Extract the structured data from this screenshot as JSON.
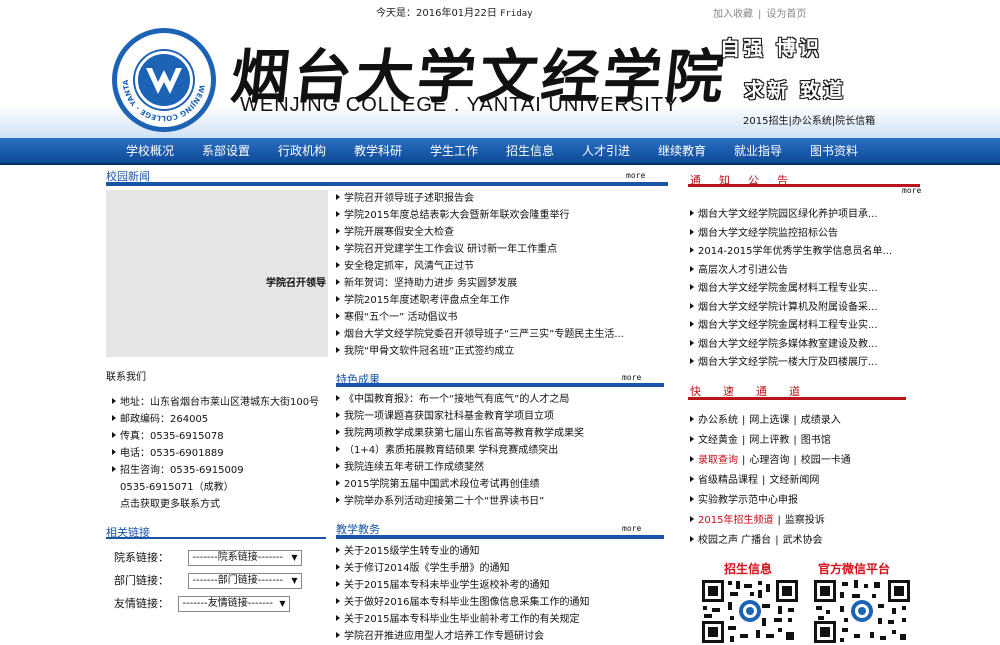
{
  "topbar": {
    "date_prefix": "今天是：2016年01月22日",
    "weekday": "Friday",
    "add_favorite": "加入收藏",
    "set_home": "设为首页",
    "separator": "|"
  },
  "header": {
    "school_name_cn": "烟台大学文经学院",
    "school_name_en": "WENJING COLLEGE . YANTAI UNIVERSITY",
    "logo_ring_text": "WENJING COLLEGE · YANTAI UNIVERSITY",
    "motto_line1": "自强 博识",
    "motto_line2": "求新 致道",
    "links": "2015招生|办公系统|院长信箱"
  },
  "nav": {
    "items": [
      "学校概况",
      "系部设置",
      "行政机构",
      "教学科研",
      "学生工作",
      "招生信息",
      "人才引进",
      "继续教育",
      "就业指导",
      "图书资料"
    ]
  },
  "campus_news": {
    "title": "校园新闻",
    "more": "more",
    "image_caption": "学院召开领导",
    "items": [
      "学院召开领导班子述职报告会",
      "学院2015年度总结表彰大会暨新年联欢会隆重举行",
      "学院开展寒假安全大检查",
      "学院召开党建学生工作会议 研讨新一年工作重点",
      "安全稳定抓牢，风清气正过节",
      "新年贺词：坚持助力进步 务实圆梦发展",
      "学院2015年度述职考评盘点全年工作",
      "寒假“五个一” 活动倡议书",
      "烟台大学文经学院党委召开领导班子“三严三实”专题民主生活...",
      "我院“甲骨文软件冠名班”正式签约成立"
    ]
  },
  "contact": {
    "title": "联系我们",
    "items": [
      "地址：山东省烟台市莱山区港城东大街100号",
      "邮政编码：264005",
      "传真：0535-6915078",
      "电话：0535-6901889",
      "招生咨询：0535-6915009"
    ],
    "extra_phone": "0535-6915071（成教）",
    "more_link": "点击获取更多联系方式"
  },
  "related_links": {
    "title": "相关链接",
    "rows": [
      {
        "label": "院系链接：",
        "value": "-------院系链接-------"
      },
      {
        "label": "部门链接：",
        "value": "-------部门链接-------"
      },
      {
        "label": "友情链接：",
        "value": "-------友情链接-------"
      }
    ]
  },
  "featured": {
    "title": "特色成果",
    "more": "more",
    "items": [
      "《中国教育报》：布一个“接地气有底气”的人才之局",
      "我院一项课题喜获国家社科基金教育学项目立项",
      "我院两项教学成果获第七届山东省高等教育教学成果奖",
      "（1+4）素质拓展教育结硕果 学科竞赛成绩突出",
      "我院连续五年考研工作成绩斐然",
      "2015学院第五届中国武术段位考试再创佳绩",
      "学院举办系列活动迎接第二十个“世界读书日”"
    ]
  },
  "teaching": {
    "title": "教学教务",
    "more": "more",
    "items": [
      "关于2015级学生转专业的通知",
      "关于修订2014版《学生手册》的通知",
      "关于2015届本专科未毕业学生返校补考的通知",
      "关于做好2016届本专科毕业生图像信息采集工作的通知",
      "关于2015届本专科毕业生毕业前补考工作的有关规定",
      "学院召开推进应用型人才培养工作专题研讨会"
    ]
  },
  "notices": {
    "title": "通知公告",
    "more": "more",
    "items": [
      "烟台大学文经学院园区绿化养护项目承...",
      "烟台大学文经学院监控招标公告",
      "2014-2015学年优秀学生教学信息员名单...",
      "高层次人才引进公告",
      "烟台大学文经学院金属材料工程专业实...",
      "烟台大学文经学院计算机及附属设备采...",
      "烟台大学文经学院金属材料工程专业实...",
      "烟台大学文经学院多媒体教室建设及教...",
      "烟台大学文经学院一楼大厅及四楼展厅..."
    ]
  },
  "quick_links": {
    "title": "快速通道",
    "rows": [
      [
        "办公系统",
        "网上选课",
        "成绩录入"
      ],
      [
        "文经黄金",
        "网上评教",
        "图书馆"
      ],
      [
        "录取查询",
        "心理咨询",
        "校园一卡通"
      ],
      [
        "省级精品课程",
        "文经新闻网"
      ],
      [
        "实验教学示范中心申报"
      ],
      [
        "2015年招生频道",
        "监察投诉"
      ],
      [
        "校园之声 广播台",
        "武术协会"
      ]
    ],
    "red_items": [
      "录取查询",
      "2015年招生频道"
    ]
  },
  "qr": {
    "admission_title": "招生信息",
    "wechat_title": "官方微信平台"
  },
  "colors": {
    "nav_blue": "#0e4a98",
    "section_blue": "#1a54a6",
    "accent_red": "#b8141a"
  }
}
